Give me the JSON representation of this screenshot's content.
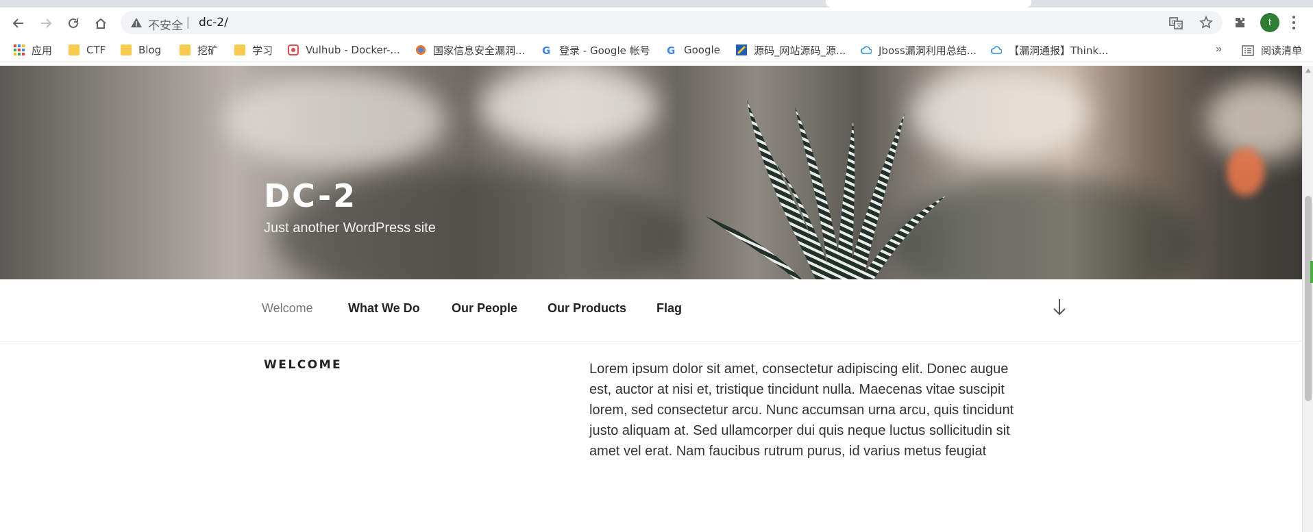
{
  "browser": {
    "security_label": "不安全",
    "url": "dc-2/",
    "avatar_initial": "t",
    "bookmarks": [
      {
        "label": "应用",
        "icon": "apps-grid-icon"
      },
      {
        "label": "CTF",
        "icon": "folder-icon"
      },
      {
        "label": "Blog",
        "icon": "folder-icon"
      },
      {
        "label": "挖矿",
        "icon": "folder-icon"
      },
      {
        "label": "学习",
        "icon": "folder-icon"
      },
      {
        "label": "Vulhub - Docker-...",
        "icon": "vulhub-favicon"
      },
      {
        "label": "国家信息安全漏洞...",
        "icon": "cnnvd-favicon"
      },
      {
        "label": "登录 - Google 帐号",
        "icon": "google-favicon"
      },
      {
        "label": "Google",
        "icon": "google-favicon"
      },
      {
        "label": "源码_网站源码_源...",
        "icon": "source-site-favicon"
      },
      {
        "label": "Jboss漏洞利用总结...",
        "icon": "cloud-favicon"
      },
      {
        "label": "【漏洞通报】Think...",
        "icon": "cloud-favicon"
      }
    ],
    "more_bookmarks": "»",
    "reading_list": "阅读清单"
  },
  "site": {
    "title": "DC-2",
    "description": "Just another WordPress site"
  },
  "nav": {
    "items": [
      "Welcome",
      "What We Do",
      "Our People",
      "Our Products",
      "Flag"
    ],
    "active": "Welcome"
  },
  "content": {
    "heading": "WELCOME",
    "body": "Lorem ipsum dolor sit amet, consectetur adipiscing elit. Donec augue est, auctor at nisi et, tristique tincidunt nulla. Maecenas vitae suscipit lorem, sed consectetur arcu. Nunc accumsan urna arcu, quis tincidunt justo aliquam at. Sed ullamcorper dui quis neque luctus sollicitudin sit amet vel erat. Nam faucibus rutrum purus, id varius metus feugiat"
  },
  "colors": {
    "folder": "#f7cb4d",
    "avatar": "#2d7d32",
    "omnibox": "#f1f3f4"
  }
}
